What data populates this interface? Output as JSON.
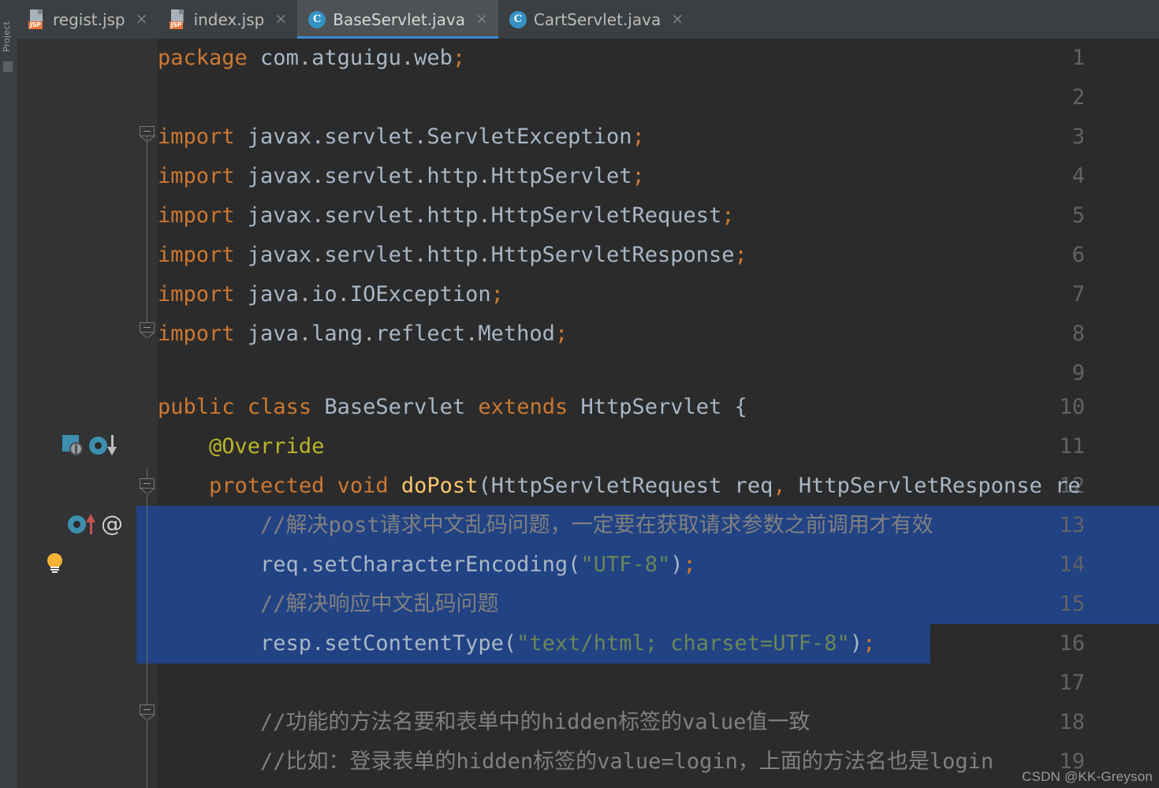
{
  "toolwindow": {
    "label": "Project"
  },
  "tabs": [
    {
      "label": "regist.jsp",
      "icon": "jsp-file-icon",
      "badge": "JSP",
      "type": "jsp",
      "active": false,
      "close": "×"
    },
    {
      "label": "index.jsp",
      "icon": "jsp-file-icon",
      "badge": "JSP",
      "type": "jsp",
      "active": false,
      "close": "×"
    },
    {
      "label": "BaseServlet.java",
      "icon": "java-class-icon",
      "badge": "C",
      "type": "java",
      "active": true,
      "close": "×"
    },
    {
      "label": "CartServlet.java",
      "icon": "java-class-icon",
      "badge": "C",
      "type": "java",
      "active": false,
      "close": "×"
    }
  ],
  "editor": {
    "active_file": "BaseServlet.java",
    "colors": {
      "background": "#2B2B2B",
      "gutter": "#313335",
      "selection": "#214283",
      "keyword": "#CC7832",
      "string": "#6A8759",
      "comment": "#808080",
      "identifier": "#A9B7C6",
      "method": "#FFC66D",
      "annotation": "#BBB529",
      "line_number": "#606366",
      "tab_active_underline": "#3C88D8"
    },
    "lines": [
      {
        "n": "1",
        "text": "package com.atguigu.web;"
      },
      {
        "n": "2",
        "text": ""
      },
      {
        "n": "3",
        "text": "import javax.servlet.ServletException;"
      },
      {
        "n": "4",
        "text": "import javax.servlet.http.HttpServlet;"
      },
      {
        "n": "5",
        "text": "import javax.servlet.http.HttpServletRequest;"
      },
      {
        "n": "6",
        "text": "import javax.servlet.http.HttpServletResponse;"
      },
      {
        "n": "7",
        "text": "import java.io.IOException;"
      },
      {
        "n": "8",
        "text": "import java.lang.reflect.Method;"
      },
      {
        "n": "9",
        "text": ""
      },
      {
        "n": "10",
        "text": "public class BaseServlet extends HttpServlet {"
      },
      {
        "n": "11",
        "text": "    @Override"
      },
      {
        "n": "12",
        "text": "    protected void doPost(HttpServletRequest req, HttpServletResponse re"
      },
      {
        "n": "13",
        "text": "        //解决post请求中文乱码问题，一定要在获取请求参数之前调用才有效"
      },
      {
        "n": "14",
        "text": "        req.setCharacterEncoding(\"UTF-8\");"
      },
      {
        "n": "15",
        "text": "        //解决响应中文乱码问题"
      },
      {
        "n": "16",
        "text": "        resp.setContentType(\"text/html; charset=UTF-8\");"
      },
      {
        "n": "17",
        "text": ""
      },
      {
        "n": "18",
        "text": "        //功能的方法名要和表单中的hidden标签的value值一致"
      },
      {
        "n": "19",
        "text": "        //比如：登录表单的hidden标签的value=login，上面的方法名也是login"
      }
    ],
    "tokens": {
      "l1": [
        {
          "t": "package",
          "c": "kw"
        },
        {
          "t": " com.atguigu.web",
          "c": "id"
        },
        {
          "t": ";",
          "c": "kw"
        }
      ],
      "l3": [
        {
          "t": "import",
          "c": "kw"
        },
        {
          "t": " javax.servlet.ServletException",
          "c": "id"
        },
        {
          "t": ";",
          "c": "kw"
        }
      ],
      "l4": [
        {
          "t": "import",
          "c": "kw"
        },
        {
          "t": " javax.servlet.http.HttpServlet",
          "c": "id"
        },
        {
          "t": ";",
          "c": "kw"
        }
      ],
      "l5": [
        {
          "t": "import",
          "c": "kw"
        },
        {
          "t": " javax.servlet.http.HttpServletRequest",
          "c": "id"
        },
        {
          "t": ";",
          "c": "kw"
        }
      ],
      "l6": [
        {
          "t": "import",
          "c": "kw"
        },
        {
          "t": " javax.servlet.http.HttpServletResponse",
          "c": "id"
        },
        {
          "t": ";",
          "c": "kw"
        }
      ],
      "l7": [
        {
          "t": "import",
          "c": "kw"
        },
        {
          "t": " java.io.IOException",
          "c": "id"
        },
        {
          "t": ";",
          "c": "kw"
        }
      ],
      "l8": [
        {
          "t": "import",
          "c": "kw"
        },
        {
          "t": " java.lang.reflect.Method",
          "c": "id"
        },
        {
          "t": ";",
          "c": "kw"
        }
      ],
      "l10": [
        {
          "t": "public",
          "c": "kw"
        },
        {
          "t": " ",
          "c": "id"
        },
        {
          "t": "class",
          "c": "kw"
        },
        {
          "t": " BaseServlet ",
          "c": "id"
        },
        {
          "t": "extends",
          "c": "kw"
        },
        {
          "t": " HttpServlet {",
          "c": "id"
        }
      ],
      "l11": [
        {
          "t": "    ",
          "c": "id"
        },
        {
          "t": "@Override",
          "c": "anno"
        }
      ],
      "l12": [
        {
          "t": "    ",
          "c": "id"
        },
        {
          "t": "protected",
          "c": "kw"
        },
        {
          "t": " ",
          "c": "id"
        },
        {
          "t": "void",
          "c": "kw"
        },
        {
          "t": " ",
          "c": "id"
        },
        {
          "t": "doPost",
          "c": "mth"
        },
        {
          "t": "(HttpServletRequest req",
          "c": "id"
        },
        {
          "t": ",",
          "c": "kw"
        },
        {
          "t": " HttpServletResponse re",
          "c": "id"
        }
      ],
      "l13": [
        {
          "t": "        ",
          "c": "id"
        },
        {
          "t": "//解决post请求中文乱码问题，一定要在获取请求参数之前调用才有效",
          "c": "cmt"
        }
      ],
      "l14": [
        {
          "t": "        req.setCharacterEncoding(",
          "c": "id"
        },
        {
          "t": "\"UTF-8\"",
          "c": "str"
        },
        {
          "t": ")",
          "c": "id"
        },
        {
          "t": ";",
          "c": "kw"
        }
      ],
      "l15": [
        {
          "t": "        ",
          "c": "id"
        },
        {
          "t": "//解决响应中文乱码问题",
          "c": "cmt"
        }
      ],
      "l16": [
        {
          "t": "        resp.setContentType(",
          "c": "id"
        },
        {
          "t": "\"text/html; charset=UTF-8\"",
          "c": "str"
        },
        {
          "t": ")",
          "c": "id"
        },
        {
          "t": ";",
          "c": "kw"
        }
      ],
      "l18": [
        {
          "t": "        ",
          "c": "id"
        },
        {
          "t": "//功能的方法名要和表单中的hidden标签的value值一致",
          "c": "cmt"
        }
      ],
      "l19": [
        {
          "t": "        ",
          "c": "id"
        },
        {
          "t": "//比如：登录表单的hidden标签的value=login，上面的方法名也是login",
          "c": "cmt"
        }
      ]
    },
    "gutter_icons": {
      "line10": [
        "servlet-mapping-icon",
        "implementing-method-icon"
      ],
      "line12": [
        "implemented-method-icon",
        "annotation-icon"
      ],
      "line13": [
        "intention-bulb-icon"
      ],
      "annotation_at": "@"
    },
    "selection": {
      "start_line": "13",
      "end_line": "16",
      "end_column_label": ";"
    }
  },
  "watermark": {
    "text": "CSDN @KK-Greyson"
  }
}
